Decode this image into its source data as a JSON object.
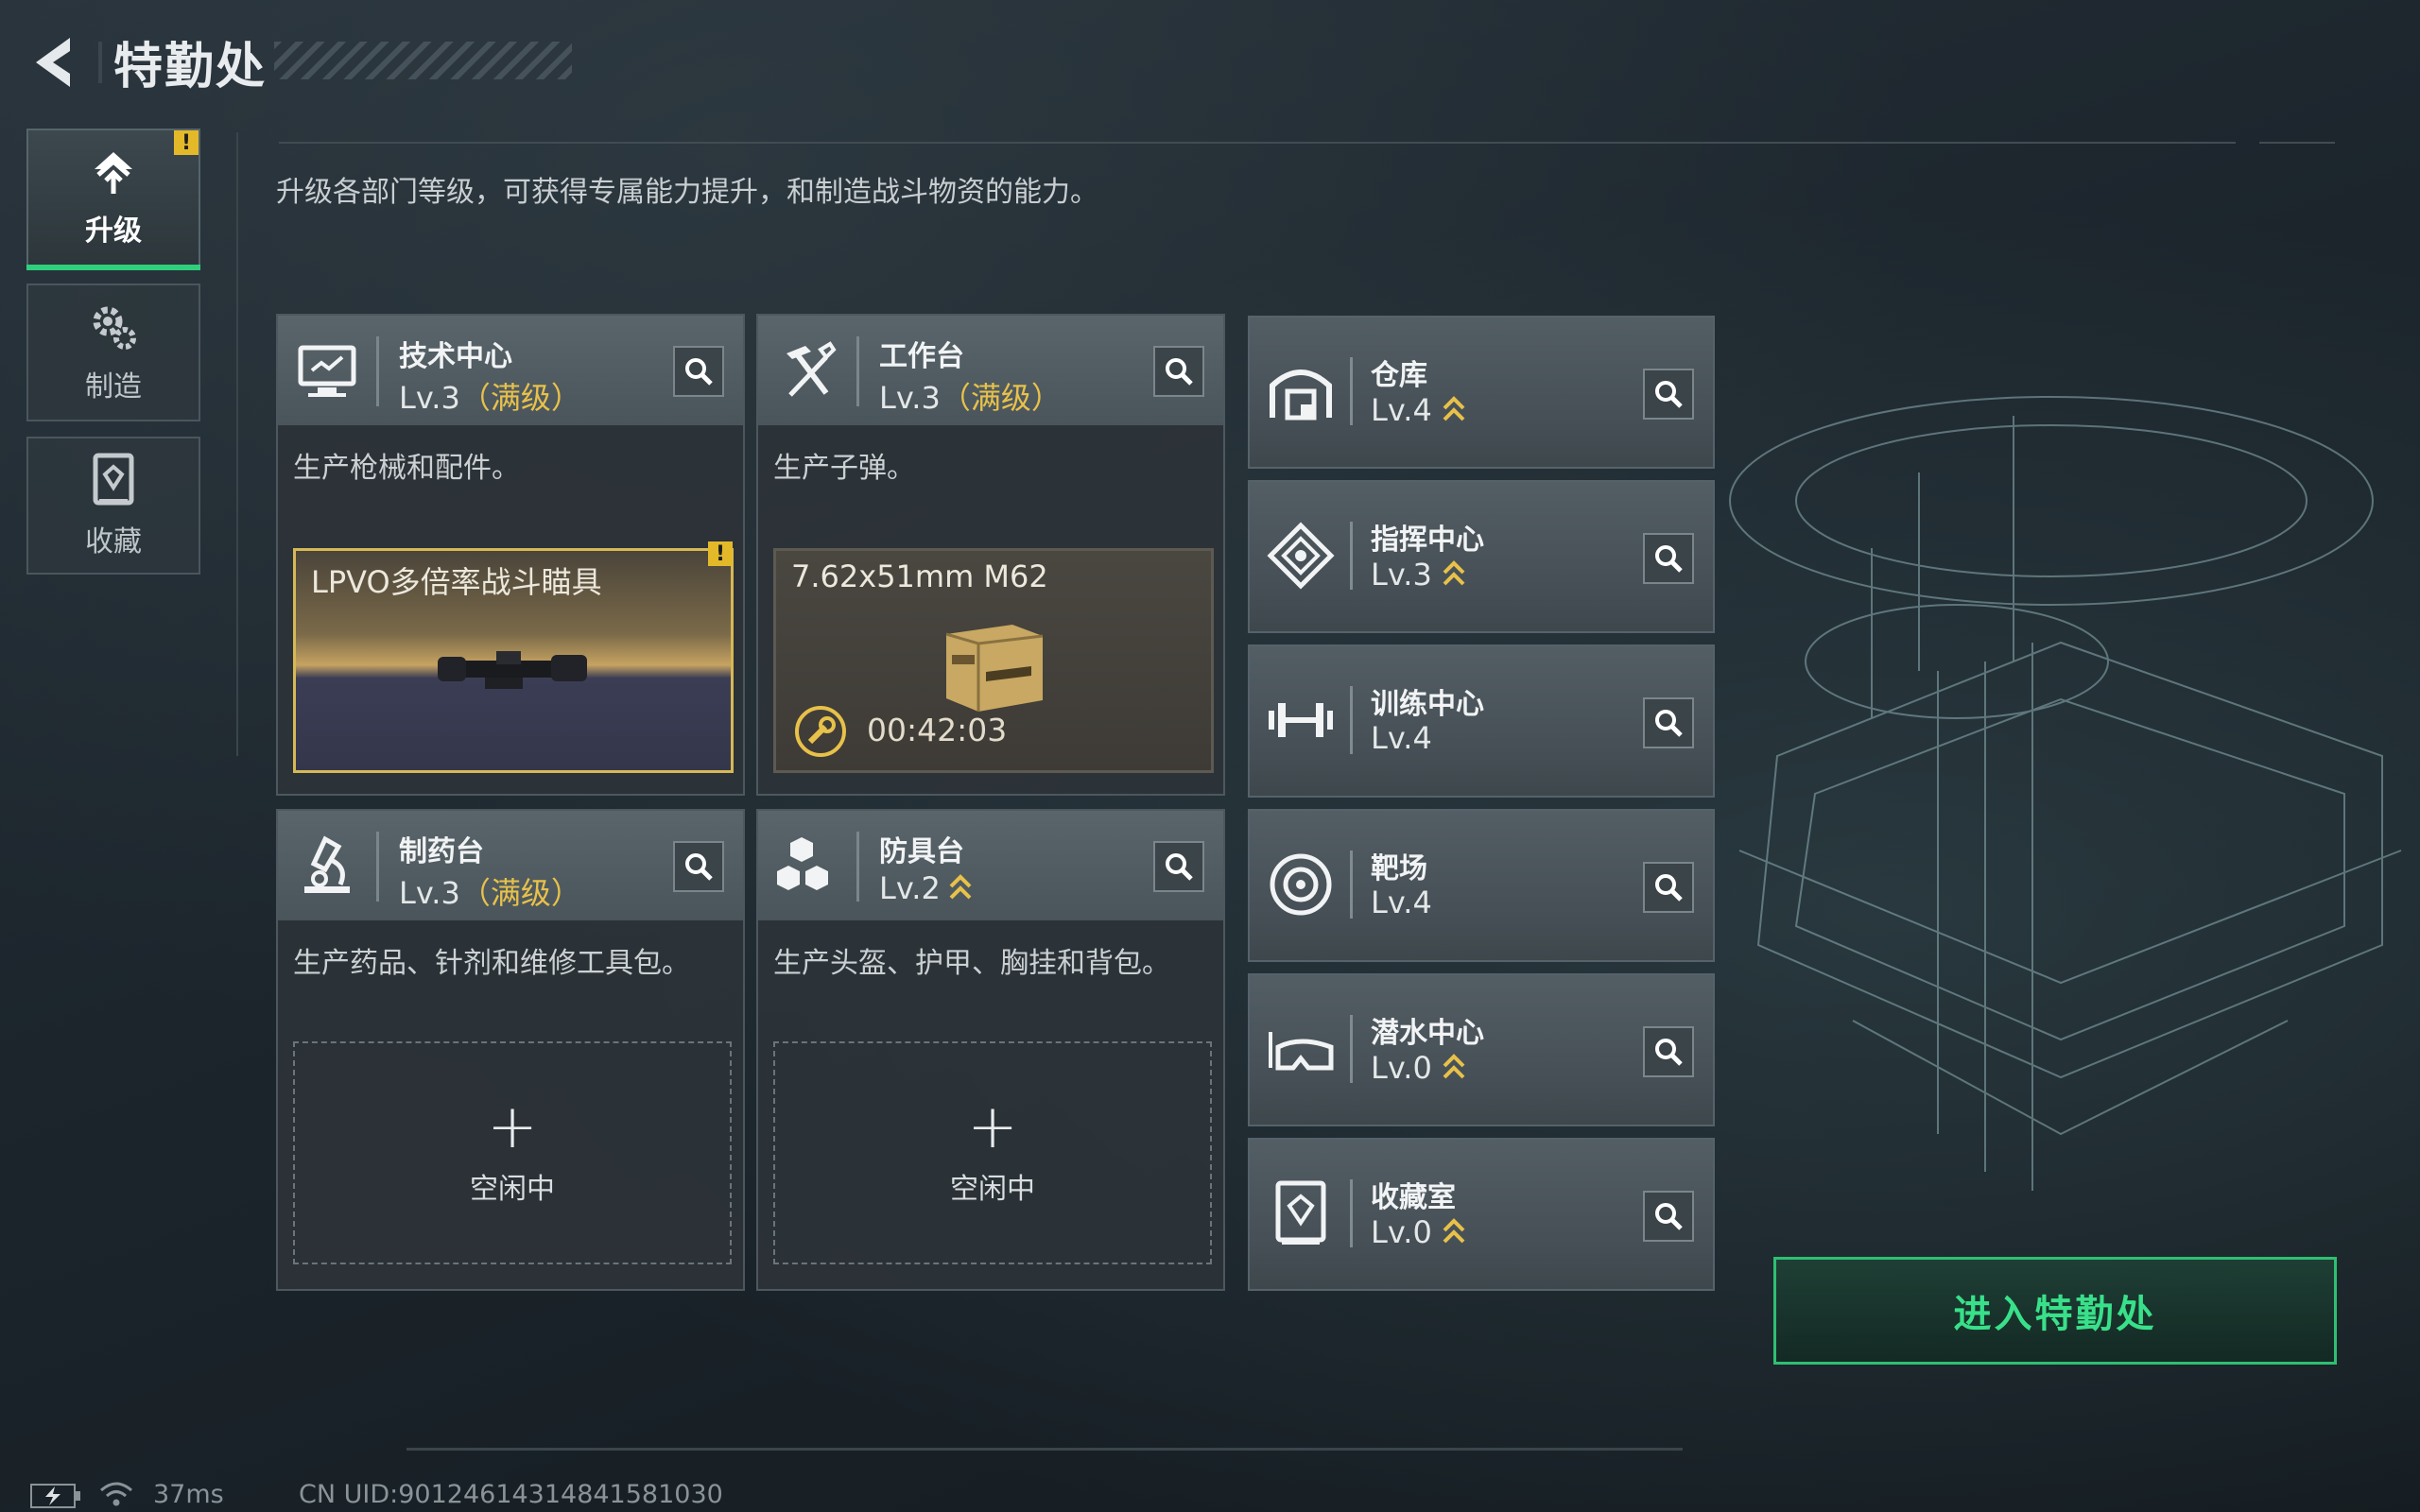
{
  "header": {
    "title": "特勤处"
  },
  "side_tabs": [
    {
      "label": "升级",
      "icon": "upgrade-icon",
      "active": true,
      "alert": "!"
    },
    {
      "label": "制造",
      "icon": "gear-icon",
      "active": false
    },
    {
      "label": "收藏",
      "icon": "collection-icon",
      "active": false
    }
  ],
  "description": "升级各部门等级，可获得专属能力提升，和制造战斗物资的能力。",
  "cards": [
    {
      "name": "技术中心",
      "level": "Lv.3",
      "max": "（满级）",
      "icon": "computer-icon",
      "desc": "生产枪械和配件。",
      "slot": {
        "name": "LPVO多倍率战斗瞄具",
        "alert": "!"
      }
    },
    {
      "name": "工作台",
      "level": "Lv.3",
      "max": "（满级）",
      "icon": "tools-icon",
      "desc": "生产子弹。",
      "slot": {
        "name": "7.62x51mm M62",
        "timer": "00:42:03"
      }
    },
    {
      "name": "制药台",
      "level": "Lv.3",
      "max": "（满级）",
      "icon": "microscope-icon",
      "desc": "生产药品、针剂和维修工具包。",
      "idle": {
        "plus": "+",
        "text": "空闲中"
      }
    },
    {
      "name": "防具台",
      "level": "Lv.2",
      "icon": "armor-icon",
      "desc": "生产头盔、护甲、胸挂和背包。",
      "idle": {
        "plus": "+",
        "text": "空闲中"
      }
    }
  ],
  "rows": [
    {
      "name": "仓库",
      "level": "Lv.4",
      "icon": "warehouse-icon",
      "upgradeable": true
    },
    {
      "name": "指挥中心",
      "level": "Lv.3",
      "icon": "command-icon",
      "upgradeable": true
    },
    {
      "name": "训练中心",
      "level": "Lv.4",
      "icon": "dumbbell-icon",
      "upgradeable": false
    },
    {
      "name": "靶场",
      "level": "Lv.4",
      "icon": "target-icon",
      "upgradeable": false
    },
    {
      "name": "潜水中心",
      "level": "Lv.0",
      "icon": "diving-mask-icon",
      "upgradeable": true
    },
    {
      "name": "收藏室",
      "level": "Lv.0",
      "icon": "collection-icon",
      "upgradeable": true
    }
  ],
  "enter_button": "进入特勤处",
  "footer": {
    "ping": "37ms",
    "uid": "CN UID:9012461431484158103​0"
  },
  "colors": {
    "accent_green": "#2fd07c",
    "max_level_gold": "#e8c14a",
    "alert_yellow": "#e3b92a"
  }
}
